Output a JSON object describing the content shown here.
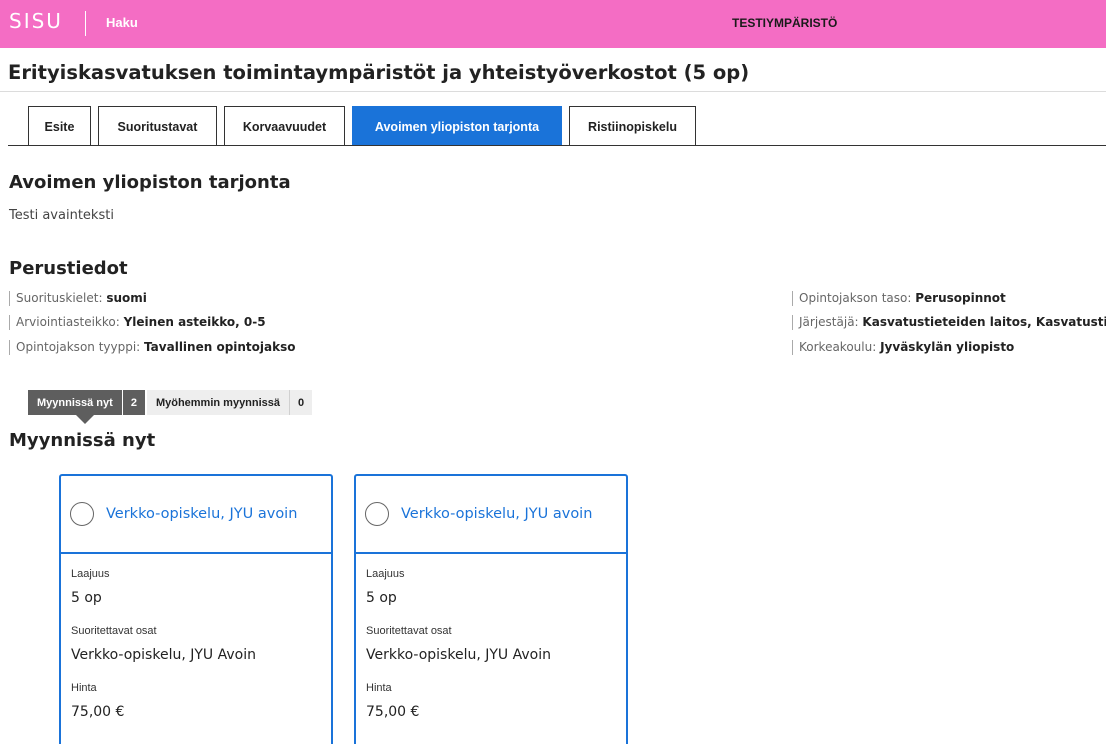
{
  "topbar": {
    "logo": "SISU",
    "search_link": "Haku",
    "environment": "TESTIYMPÄRISTÖ",
    "background": "#f46dc4"
  },
  "page": {
    "title": "Erityiskasvatuksen toimintaympäristöt ja yhteistyöverkostot (5 op)"
  },
  "tabs": [
    {
      "label": "Esite",
      "active": false
    },
    {
      "label": "Suoritustavat",
      "active": false
    },
    {
      "label": "Korvaavuudet",
      "active": false
    },
    {
      "label": "Avoimen yliopiston tarjonta",
      "active": true
    },
    {
      "label": "Ristiinopiskelu",
      "active": false
    }
  ],
  "section": {
    "heading": "Avoimen yliopiston tarjonta",
    "intro": "Testi avainteksti"
  },
  "basic_info": {
    "heading": "Perustiedot",
    "left": [
      {
        "key": "Suorituskielet:",
        "value": "suomi"
      },
      {
        "key": "Arviointiasteikko:",
        "value": "Yleinen asteikko, 0-5"
      },
      {
        "key": "Opintojakson tyyppi:",
        "value": "Tavallinen opintojakso"
      }
    ],
    "right": [
      {
        "key": "Opintojakson taso:",
        "value": "Perusopinnot"
      },
      {
        "key": "Järjestäjä:",
        "value": "Kasvatustieteiden laitos, Kasvatustiet"
      },
      {
        "key": "Korkeakoulu:",
        "value": "Jyväskylän yliopisto"
      }
    ]
  },
  "sales_toggle": {
    "now_label": "Myynnissä nyt",
    "now_count": "2",
    "later_label": "Myöhemmin myynnissä",
    "later_count": "0"
  },
  "sales_now": {
    "heading": "Myynnissä nyt"
  },
  "offerings": [
    {
      "title": "Verkko-opiskelu, JYU avoin",
      "scope_label": "Laajuus",
      "scope_value": "5 op",
      "parts_label": "Suoritettavat osat",
      "parts_value": "Verkko-opiskelu, JYU Avoin",
      "price_label": "Hinta",
      "price_value": "75,00 €"
    },
    {
      "title": "Verkko-opiskelu, JYU avoin",
      "scope_label": "Laajuus",
      "scope_value": "5 op",
      "parts_label": "Suoritettavat osat",
      "parts_value": "Verkko-opiskelu, JYU Avoin",
      "price_label": "Hinta",
      "price_value": "75,00 €"
    }
  ],
  "colors": {
    "accent": "#1a73d9",
    "toggle_selected": "#5e5e5e"
  }
}
